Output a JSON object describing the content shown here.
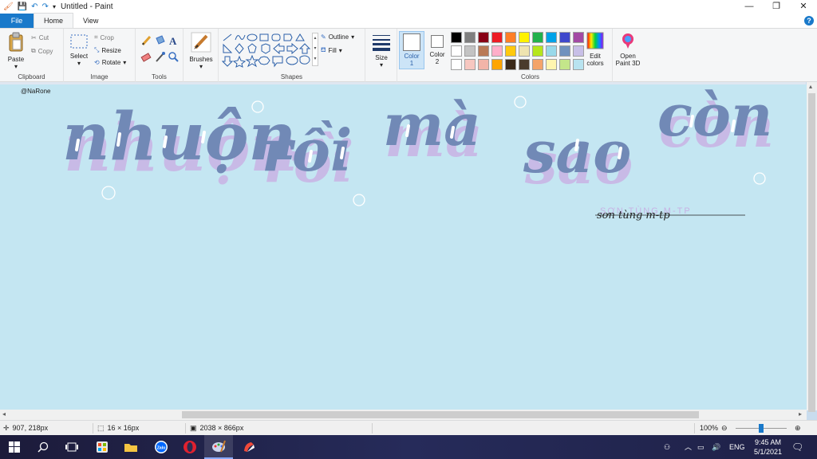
{
  "window": {
    "title": "Untitled - Paint"
  },
  "tabs": [
    {
      "label": "File"
    },
    {
      "label": "Home"
    },
    {
      "label": "View"
    }
  ],
  "ribbon": {
    "clipboard": {
      "label": "Clipboard",
      "paste": "Paste",
      "cut": "Cut",
      "copy": "Copy"
    },
    "image": {
      "label": "Image",
      "select": "Select",
      "crop": "Crop",
      "resize": "Resize",
      "rotate": "Rotate"
    },
    "tools": {
      "label": "Tools"
    },
    "brushes": {
      "label": "Brushes"
    },
    "shapes": {
      "label": "Shapes",
      "outline": "Outline",
      "fill": "Fill"
    },
    "size": {
      "label": "Size"
    },
    "color1": {
      "label": "Color",
      "num": "1"
    },
    "color2": {
      "label": "Color",
      "num": "2"
    },
    "colors": {
      "label": "Colors"
    },
    "edit_colors": {
      "line1": "Edit",
      "line2": "colors"
    },
    "paint3d": {
      "line1": "Open",
      "line2": "Paint 3D"
    }
  },
  "palette": {
    "row1": [
      "#000000",
      "#7f7f7f",
      "#880015",
      "#ed1c24",
      "#ff7f27",
      "#fff200",
      "#22b14c",
      "#00a2e8",
      "#3f48cc",
      "#a349a4"
    ],
    "row2": [
      "#ffffff",
      "#c3c3c3",
      "#b97a57",
      "#ffaec9",
      "#ffc90e",
      "#efe4b0",
      "#b5e61d",
      "#99d9ea",
      "#7092be",
      "#c8bfe7"
    ],
    "row3": [
      "#ffffff",
      "#f7c7c0",
      "#f2b4a8",
      "#ffa500",
      "#3b2a1a",
      "#4a3b2c",
      "#f4a46a",
      "#fff5b0",
      "#c4e68a",
      "#b8e3f0"
    ]
  },
  "canvas": {
    "bg_color": "#c4e6f2",
    "watermark": "@NaRone",
    "title_words": [
      "nhuộn",
      "rồi",
      "mà",
      "sao",
      "còn"
    ],
    "signature": "sơn tùng m-tp",
    "signature_shadow": "SƠN TÙNG M-TP"
  },
  "statusbar": {
    "cursor": "907, 218px",
    "selection": "16 × 16px",
    "image_size": "2038 × 866px",
    "zoom": "100%"
  },
  "taskbar": {
    "lang": "ENG",
    "time": "9:45 AM",
    "date": "5/1/2021"
  }
}
